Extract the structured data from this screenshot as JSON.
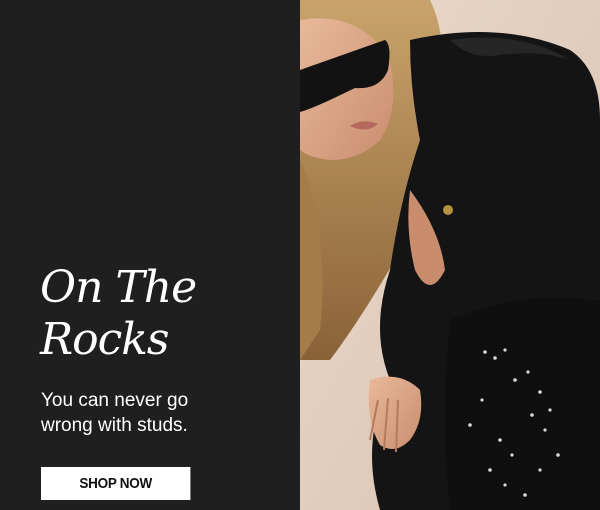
{
  "headline": {
    "line1": "On The",
    "line2": "Rocks"
  },
  "subcopy": {
    "line1": "You can never go",
    "line2": "wrong with studs."
  },
  "cta": {
    "label": "SHOP NOW"
  },
  "colors": {
    "panel_bg": "#1f1f1f",
    "text": "#ffffff",
    "button_bg": "#ffffff",
    "button_text": "#111111",
    "photo_bg": "#e4d2c3"
  },
  "photo": {
    "subject": "model-in-black-studded-outfit-and-sunglasses"
  }
}
